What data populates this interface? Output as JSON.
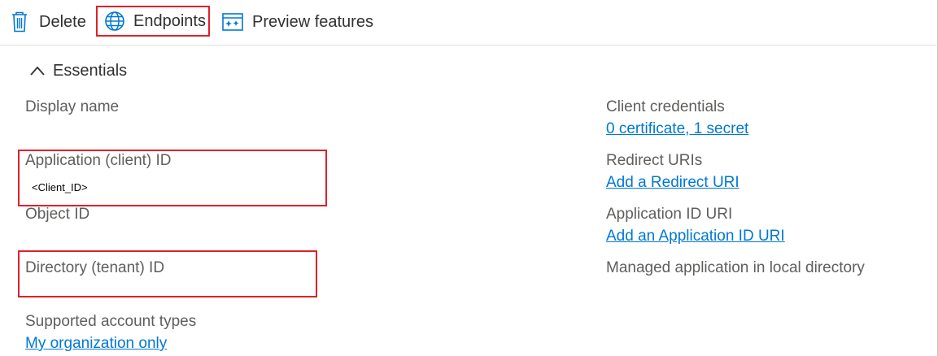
{
  "toolbar": {
    "delete_label": "Delete",
    "endpoints_label": "Endpoints",
    "preview_label": "Preview features"
  },
  "essentials": {
    "title": "Essentials"
  },
  "left_fields": {
    "display_name_label": "Display name",
    "app_id_label": "Application (client) ID",
    "app_id_value": "<Client_ID>",
    "object_id_label": "Object ID",
    "tenant_id_label": "Directory (tenant) ID",
    "account_types_label": "Supported account types",
    "account_types_link": "My organization only"
  },
  "right_fields": {
    "client_credentials_label": "Client credentials",
    "client_credentials_link": "0 certificate, 1 secret",
    "redirect_uris_label": "Redirect URIs",
    "redirect_uris_link": "Add a Redirect URI",
    "app_id_uri_label": "Application ID URI",
    "app_id_uri_link": "Add an Application ID URI",
    "managed_app_label": "Managed application in local directory"
  },
  "colors": {
    "accent": "#0078d4",
    "highlight": "#e0202b",
    "text": "#323130",
    "label": "#605e5c"
  }
}
